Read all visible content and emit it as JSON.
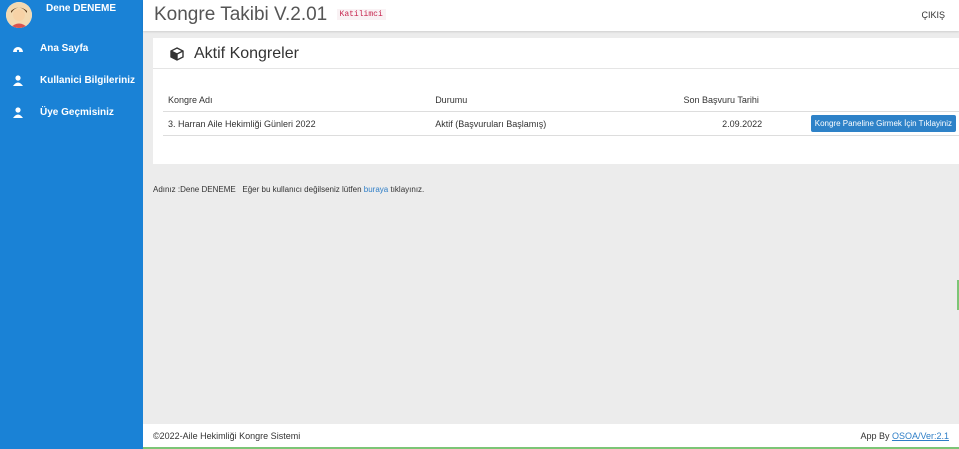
{
  "sidebar": {
    "user_name": "Dene DENEME",
    "items": [
      {
        "label": "Ana Sayfa",
        "icon": "dashboard-icon"
      },
      {
        "label": "Kullanici Bilgileriniz",
        "icon": "user-icon"
      },
      {
        "label": "Üye Geçmisiniz",
        "icon": "user-icon"
      }
    ]
  },
  "header": {
    "title": "Kongre Takibi V.2.01",
    "role_badge": "Katilimci",
    "logout_label": "ÇIKIŞ"
  },
  "panel": {
    "title": "Aktif Kongreler",
    "columns": [
      "Kongre Adı",
      "Durumu",
      "Son Başvuru Tarihi",
      ""
    ],
    "rows": [
      {
        "name": "3. Harran Aile Hekimliği Günleri 2022",
        "status": "Aktif (Başvuruları Başlamış)",
        "deadline": "2.09.2022",
        "action": "Kongre Paneline Girmek İçin Tıklayiniz"
      }
    ]
  },
  "notice": {
    "prefix": "Adınız :Dene DENEME   Eğer bu kullanıcı değilseniz lütfen ",
    "link": "buraya",
    "suffix": " tıklayınız."
  },
  "footer": {
    "left": "©2022-Aile Hekimliği Kongre Sistemi",
    "right_prefix": "App By ",
    "right_link": "OSOA/Ver:2.1"
  },
  "colors": {
    "sidebar": "#1a82d6",
    "button": "#2e82c8",
    "link": "#2e7ec7",
    "accent_green": "#7cc576"
  }
}
